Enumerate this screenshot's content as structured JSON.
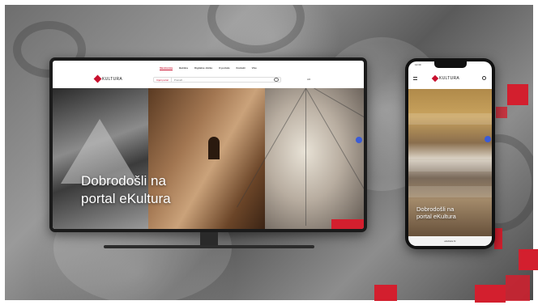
{
  "site": {
    "logo_text": "KULTURA",
    "hero_title": "Dobrodošli na portal eKultura",
    "hero_title_mobile": "Dobrodošli na portal eKultura"
  },
  "desktop": {
    "nav": [
      "Naslovnica",
      "Baština",
      "Digitalne zbirke",
      "O portalu",
      "Kontakt",
      "Više"
    ],
    "active_nav_index": 0,
    "search_select": "Cijeli portal",
    "search_placeholder": "Pretraži...",
    "language": "HR"
  },
  "phone": {
    "status_time": "12:30",
    "url": "ekultura.hr"
  },
  "colors": {
    "brand_red": "#c8102e",
    "accent_blue": "#3b5cd6",
    "square_red": "#d31f2e"
  },
  "icons": [
    "logo-mark-icon",
    "search-icon",
    "menu-icon",
    "chat-icon"
  ]
}
